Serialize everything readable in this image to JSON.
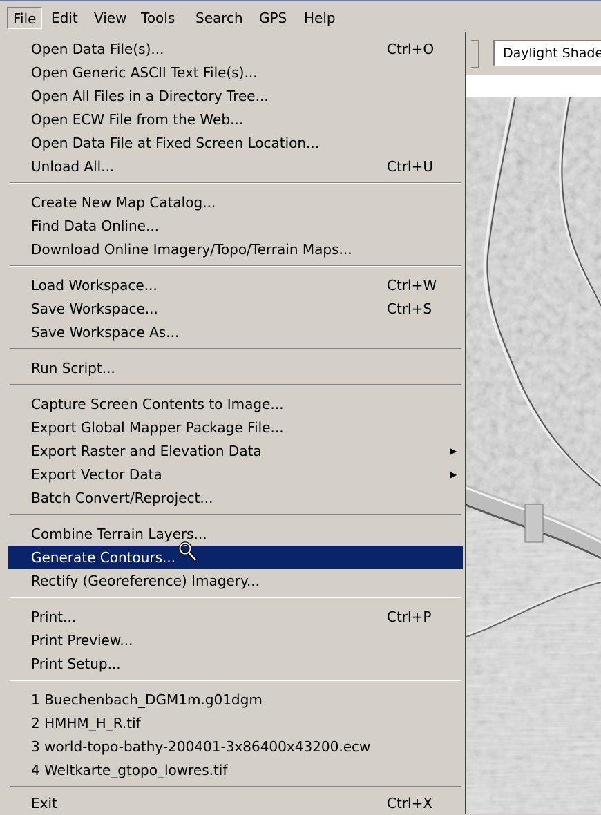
{
  "menubar": {
    "items": [
      "File",
      "Edit",
      "View",
      "Tools",
      "Search",
      "GPS",
      "Help"
    ],
    "active_index": 0
  },
  "toolbar": {
    "shader_value": "Daylight Shade"
  },
  "menu": {
    "highlight_color": "#0a246a",
    "items": [
      {
        "label": "Open Data File(s)...",
        "shortcut": "Ctrl+O"
      },
      {
        "label": "Open Generic ASCII Text File(s)...",
        "shortcut": ""
      },
      {
        "label": "Open All Files in a Directory Tree...",
        "shortcut": ""
      },
      {
        "label": "Open ECW File from the Web...",
        "shortcut": ""
      },
      {
        "label": "Open Data File at Fixed Screen Location...",
        "shortcut": ""
      },
      {
        "label": "Unload All...",
        "shortcut": "Ctrl+U"
      },
      {
        "label": "Create New Map Catalog...",
        "shortcut": ""
      },
      {
        "label": "Find Data Online...",
        "shortcut": ""
      },
      {
        "label": "Download Online Imagery/Topo/Terrain Maps...",
        "shortcut": ""
      },
      {
        "label": "Load Workspace...",
        "shortcut": "Ctrl+W"
      },
      {
        "label": "Save Workspace...",
        "shortcut": "Ctrl+S"
      },
      {
        "label": "Save Workspace As...",
        "shortcut": ""
      },
      {
        "label": "Run Script...",
        "shortcut": ""
      },
      {
        "label": "Capture Screen Contents to Image...",
        "shortcut": ""
      },
      {
        "label": "Export Global Mapper Package File...",
        "shortcut": ""
      },
      {
        "label": "Export Raster and Elevation Data",
        "shortcut": "",
        "submenu": true
      },
      {
        "label": "Export Vector Data",
        "shortcut": "",
        "submenu": true
      },
      {
        "label": "Batch Convert/Reproject...",
        "shortcut": ""
      },
      {
        "label": "Combine Terrain Layers...",
        "shortcut": ""
      },
      {
        "label": "Generate Contours...",
        "shortcut": "",
        "highlighted": true
      },
      {
        "label": "Rectify (Georeference) Imagery...",
        "shortcut": ""
      },
      {
        "label": "Print...",
        "shortcut": "Ctrl+P"
      },
      {
        "label": "Print Preview...",
        "shortcut": ""
      },
      {
        "label": "Print Setup...",
        "shortcut": ""
      },
      {
        "label": "1 Buechenbach_DGM1m.g01dgm",
        "shortcut": ""
      },
      {
        "label": "2 HMHM_H_R.tif",
        "shortcut": ""
      },
      {
        "label": "3 world-topo-bathy-200401-3x86400x43200.ecw",
        "shortcut": ""
      },
      {
        "label": "4 Weltkarte_gtopo_lowres.tif",
        "shortcut": ""
      },
      {
        "label": "Exit",
        "shortcut": "Ctrl+X"
      }
    ],
    "submenu_glyph": "▶"
  }
}
